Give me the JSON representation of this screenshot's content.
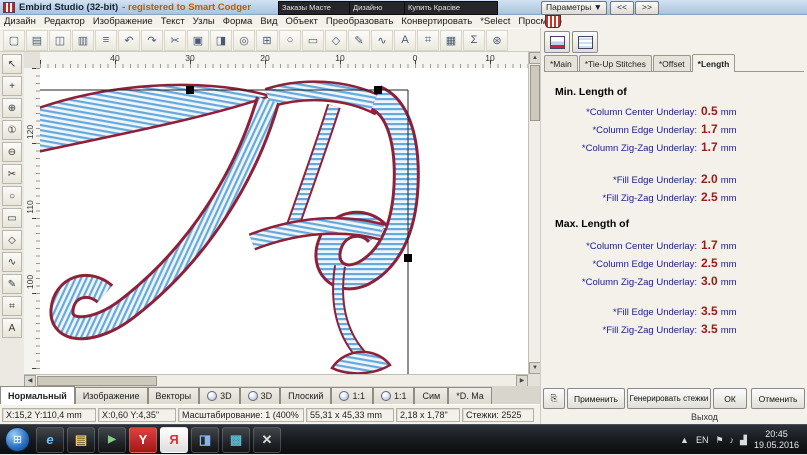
{
  "colors": {
    "stitch_blue": "#66a9da",
    "outline_red": "#8e2139",
    "label_blue": "#1b1b8e",
    "value_red": "#9e1a1a"
  },
  "title_bar": {
    "title": "Embird Studio (32-bit)",
    "registration": "- registered to Smart Codger",
    "preview_windows": [
      "Заказы Масте",
      "Дизайно",
      "Купить Красіве"
    ],
    "parameters_button": "Параметры ▼",
    "collapse_button": "<<",
    "expand_button": ">>"
  },
  "menu_bar": {
    "items": [
      "Дизайн",
      "Редактор",
      "Изображение",
      "Текст",
      "Узлы",
      "Форма",
      "Вид",
      "Объект",
      "Преобразовать",
      "Конвертировать",
      "*Select",
      "Просмотр"
    ]
  },
  "toolbar": {
    "icons": [
      {
        "name": "new-icon",
        "glyph": "▢"
      },
      {
        "name": "open-icon",
        "glyph": "▤"
      },
      {
        "name": "save-icon",
        "glyph": "◫"
      },
      {
        "name": "import-icon",
        "glyph": "▥"
      },
      {
        "name": "print-icon",
        "glyph": "≡"
      },
      {
        "name": "undo-icon",
        "glyph": "↶"
      },
      {
        "name": "redo-icon",
        "glyph": "↷"
      },
      {
        "name": "cut-icon",
        "glyph": "✂"
      },
      {
        "name": "copy-icon",
        "glyph": "▣"
      },
      {
        "name": "paste-icon",
        "glyph": "◨"
      },
      {
        "name": "zoom-icon",
        "glyph": "◎"
      },
      {
        "name": "grid-icon",
        "glyph": "⊞"
      },
      {
        "name": "ellipse-icon",
        "glyph": "○"
      },
      {
        "name": "rect-icon",
        "glyph": "▭"
      },
      {
        "name": "polygon-icon",
        "glyph": "◇"
      },
      {
        "name": "pencil-icon",
        "glyph": "✎"
      },
      {
        "name": "curve-icon",
        "glyph": "∿"
      },
      {
        "name": "text-icon",
        "glyph": "A"
      },
      {
        "name": "measure-icon",
        "glyph": "⌗"
      },
      {
        "name": "layers-icon",
        "glyph": "▦"
      },
      {
        "name": "sum-icon",
        "glyph": "Σ"
      },
      {
        "name": "settings-icon",
        "glyph": "⊛"
      }
    ]
  },
  "left_toolbar": {
    "tools": [
      {
        "name": "pointer-tool",
        "glyph": "↖"
      },
      {
        "name": "move-tool",
        "glyph": "+"
      },
      {
        "name": "zoom-in-tool",
        "glyph": "⊕"
      },
      {
        "name": "zoom-1-tool",
        "glyph": "①"
      },
      {
        "name": "zoom-out-tool",
        "glyph": "⊖"
      },
      {
        "name": "knife-tool",
        "glyph": "✂"
      },
      {
        "name": "ellipse-tool",
        "glyph": "○"
      },
      {
        "name": "rect-tool",
        "glyph": "▭"
      },
      {
        "name": "polygon-tool",
        "glyph": "◇"
      },
      {
        "name": "curve-tool",
        "glyph": "∿"
      },
      {
        "name": "pencil-tool",
        "glyph": "✎"
      },
      {
        "name": "grid-tool",
        "glyph": "⌗"
      },
      {
        "name": "text-tool",
        "glyph": "A"
      }
    ]
  },
  "rulers": {
    "top_labels": [
      "40",
      "30",
      "20",
      "10",
      "0",
      "10"
    ],
    "left_labels": [
      "120",
      "110",
      "100"
    ]
  },
  "right_panel": {
    "tabs": [
      "*Main",
      "*Tie-Up Stitches",
      "*Offset",
      "*Length"
    ],
    "active_tab": "*Length",
    "sections": [
      {
        "header": "Min. Length of",
        "rows": [
          {
            "label": "*Column Center Underlay:",
            "value": "0.5",
            "unit": "mm"
          },
          {
            "label": "*Column Edge Underlay:",
            "value": "1.7",
            "unit": "mm"
          },
          {
            "label": "*Column Zig-Zag Underlay:",
            "value": "1.7",
            "unit": "mm"
          },
          {
            "label": "*Fill Edge Underlay:",
            "value": "2.0",
            "unit": "mm"
          },
          {
            "label": "*Fill Zig-Zag Underlay:",
            "value": "2.5",
            "unit": "mm"
          }
        ]
      },
      {
        "header": "Max. Length of",
        "rows": [
          {
            "label": "*Column Center Underlay:",
            "value": "1.7",
            "unit": "mm"
          },
          {
            "label": "*Column Edge Underlay:",
            "value": "2.5",
            "unit": "mm"
          },
          {
            "label": "*Column Zig-Zag Underlay:",
            "value": "3.0",
            "unit": "mm"
          },
          {
            "label": "*Fill Edge Underlay:",
            "value": "3.5",
            "unit": "mm"
          },
          {
            "label": "*Fill Zig-Zag Underlay:",
            "value": "3.5",
            "unit": "mm"
          }
        ]
      }
    ],
    "buttons": {
      "apply": "Применить",
      "generate": "Генерировать стежки",
      "ok": "ОК",
      "cancel": "Отменить",
      "exit": "Выход"
    }
  },
  "view_tabs": {
    "tabs": [
      {
        "label": "Нормальный",
        "radio": false
      },
      {
        "label": "Изображение",
        "radio": false
      },
      {
        "label": "Векторы",
        "radio": false
      },
      {
        "label": "3D",
        "radio": true
      },
      {
        "label": "3D",
        "radio": true
      },
      {
        "label": "Плоский",
        "radio": false
      },
      {
        "label": "1:1",
        "radio": true
      },
      {
        "label": "1:1",
        "radio": true
      },
      {
        "label": "Сим",
        "radio": false
      },
      {
        "label": "*D. Ма",
        "radio": false
      }
    ]
  },
  "status_bar": {
    "cells": [
      "X:15,2 Y:110,4 mm",
      "X:0,60 Y:4,35\"",
      "Масштабирование: 1 (400%",
      "55,31 x 45,33 mm",
      "2,18 x 1,78\"",
      "Стежки: 2525"
    ]
  },
  "taskbar": {
    "language": "EN",
    "time": "20:45",
    "date": "19.05.2016",
    "icons": [
      {
        "name": "internet-explorer-icon",
        "glyph": "e"
      },
      {
        "name": "explorer-folder-icon",
        "glyph": "▤"
      },
      {
        "name": "media-player-icon",
        "glyph": "▶"
      },
      {
        "name": "yandex-browser-icon",
        "glyph": "Y"
      },
      {
        "name": "yandex-icon",
        "glyph": "Я"
      },
      {
        "name": "paint-icon",
        "glyph": "◨"
      },
      {
        "name": "photo-viewer-icon",
        "glyph": "▩"
      },
      {
        "name": "embird-taskbar-icon",
        "glyph": "✕"
      }
    ],
    "tray_icons": [
      {
        "name": "hidden-icons-arrow",
        "glyph": "▲"
      },
      {
        "name": "action-center-icon",
        "glyph": "⚑"
      },
      {
        "name": "volume-icon",
        "glyph": "♪"
      },
      {
        "name": "network-icon",
        "glyph": "▟"
      }
    ]
  }
}
